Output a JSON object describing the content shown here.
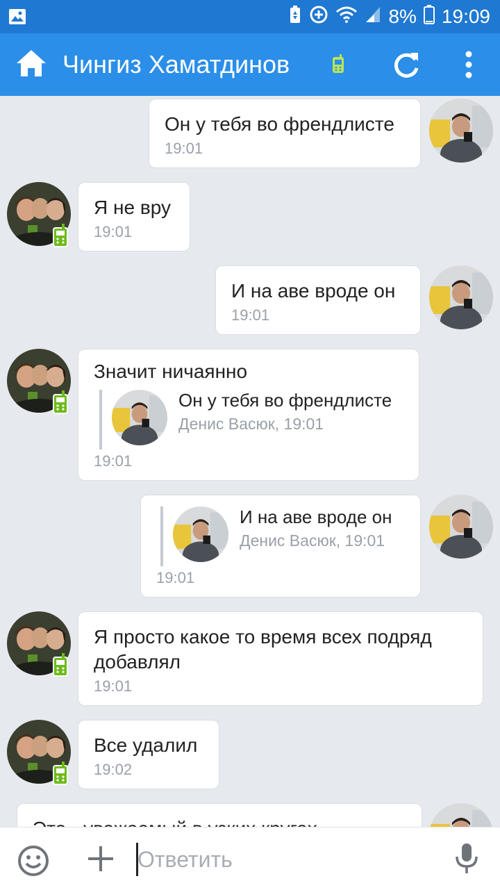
{
  "status_bar": {
    "battery_percent": "8%",
    "time": "19:09",
    "icons": [
      "gallery-icon",
      "battery-saver-icon",
      "data-saver-icon",
      "wifi-icon",
      "signal-icon",
      "battery-icon"
    ]
  },
  "app_bar": {
    "title": "Чингиз Хаматдинов",
    "icons": [
      "home-icon",
      "mobile-online-icon",
      "refresh-icon",
      "more-vert-icon"
    ]
  },
  "colors": {
    "status_bar": "#1f78d1",
    "app_bar": "#2b8ee8",
    "chat_background": "#e6e9ee",
    "mobile_badge": "#6dbb1a"
  },
  "messages": [
    {
      "side": "out",
      "text": "Он у тебя во френдлисте",
      "time": "19:01"
    },
    {
      "side": "in",
      "text": "Я не вру",
      "time": "19:01"
    },
    {
      "side": "out",
      "text": "И на аве вроде он",
      "time": "19:01"
    },
    {
      "side": "in",
      "text": "Значит ничаянно",
      "time": "19:01",
      "reply": {
        "text": "Он у тебя во френдлисте",
        "meta": "Денис Васюк, 19:01"
      }
    },
    {
      "side": "out",
      "text": "",
      "time": "19:01",
      "reply": {
        "text": "И на аве вроде он",
        "meta": "Денис Васюк, 19:01"
      }
    },
    {
      "side": "in",
      "text": "Я просто какое то время всех подряд добавлял",
      "time": "19:01"
    },
    {
      "side": "in",
      "text": "Все удалил",
      "time": "19:02"
    },
    {
      "side": "out",
      "text": "Это - уважаемый в узких кругах",
      "time": ""
    }
  ],
  "input_bar": {
    "placeholder": "Ответить",
    "value": "",
    "icons": [
      "emoji-icon",
      "attach-plus-icon",
      "microphone-icon"
    ]
  }
}
